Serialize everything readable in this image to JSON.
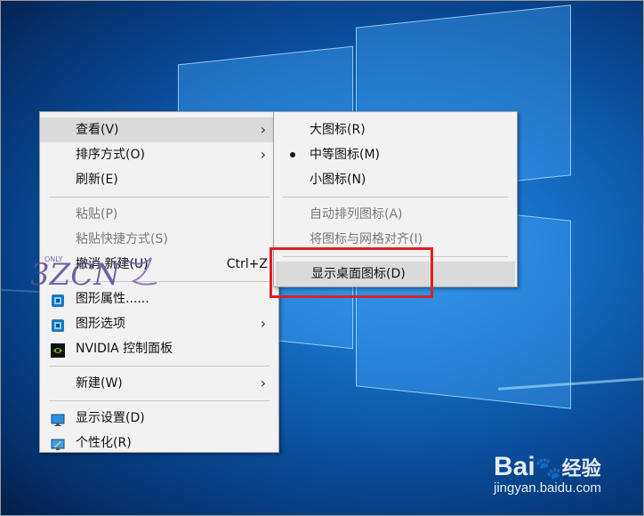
{
  "context_menu": {
    "items": [
      {
        "label": "查看(V)",
        "state": "highlighted",
        "submenu": true
      },
      {
        "label": "排序方式(O)",
        "state": "normal",
        "submenu": true
      },
      {
        "label": "刷新(E)",
        "state": "normal"
      },
      {
        "label": "粘贴(P)",
        "state": "disabled"
      },
      {
        "label": "粘贴快捷方式(S)",
        "state": "disabled"
      },
      {
        "label": "撤消 新建(U)",
        "state": "normal",
        "shortcut": "Ctrl+Z"
      },
      {
        "label": "图形属性......",
        "state": "normal",
        "icon": "intel-graphics-icon"
      },
      {
        "label": "图形选项",
        "state": "normal",
        "icon": "intel-graphics-icon",
        "submenu": true
      },
      {
        "label": "NVIDIA 控制面板",
        "state": "normal",
        "icon": "nvidia-icon"
      },
      {
        "label": "新建(W)",
        "state": "normal",
        "submenu": true
      },
      {
        "label": "显示设置(D)",
        "state": "normal",
        "icon": "display-settings-icon"
      },
      {
        "label": "个性化(R)",
        "state": "normal",
        "icon": "personalize-icon"
      }
    ]
  },
  "view_submenu": {
    "items": [
      {
        "label": "大图标(R)",
        "state": "normal"
      },
      {
        "label": "中等图标(M)",
        "state": "selected"
      },
      {
        "label": "小图标(N)",
        "state": "normal"
      },
      {
        "label": "自动排列图标(A)",
        "state": "disabled"
      },
      {
        "label": "将图标与网格对齐(I)",
        "state": "disabled"
      },
      {
        "label": "显示桌面图标(D)",
        "state": "highlighted"
      }
    ]
  },
  "annotation": {
    "color": "#e02020",
    "target": "显示桌面图标(D)"
  },
  "watermark": {
    "brand": "Bai",
    "brand_suffix": "经验",
    "url": "jingyan.baidu.com"
  },
  "overlay_logo": {
    "text": "3ZCN",
    "small_text": "ONLY"
  },
  "colors": {
    "desktop_blue": "#166fc7",
    "menu_bg": "#f2f2f2",
    "highlight": "#dadada",
    "disabled": "#7a7a7a"
  }
}
